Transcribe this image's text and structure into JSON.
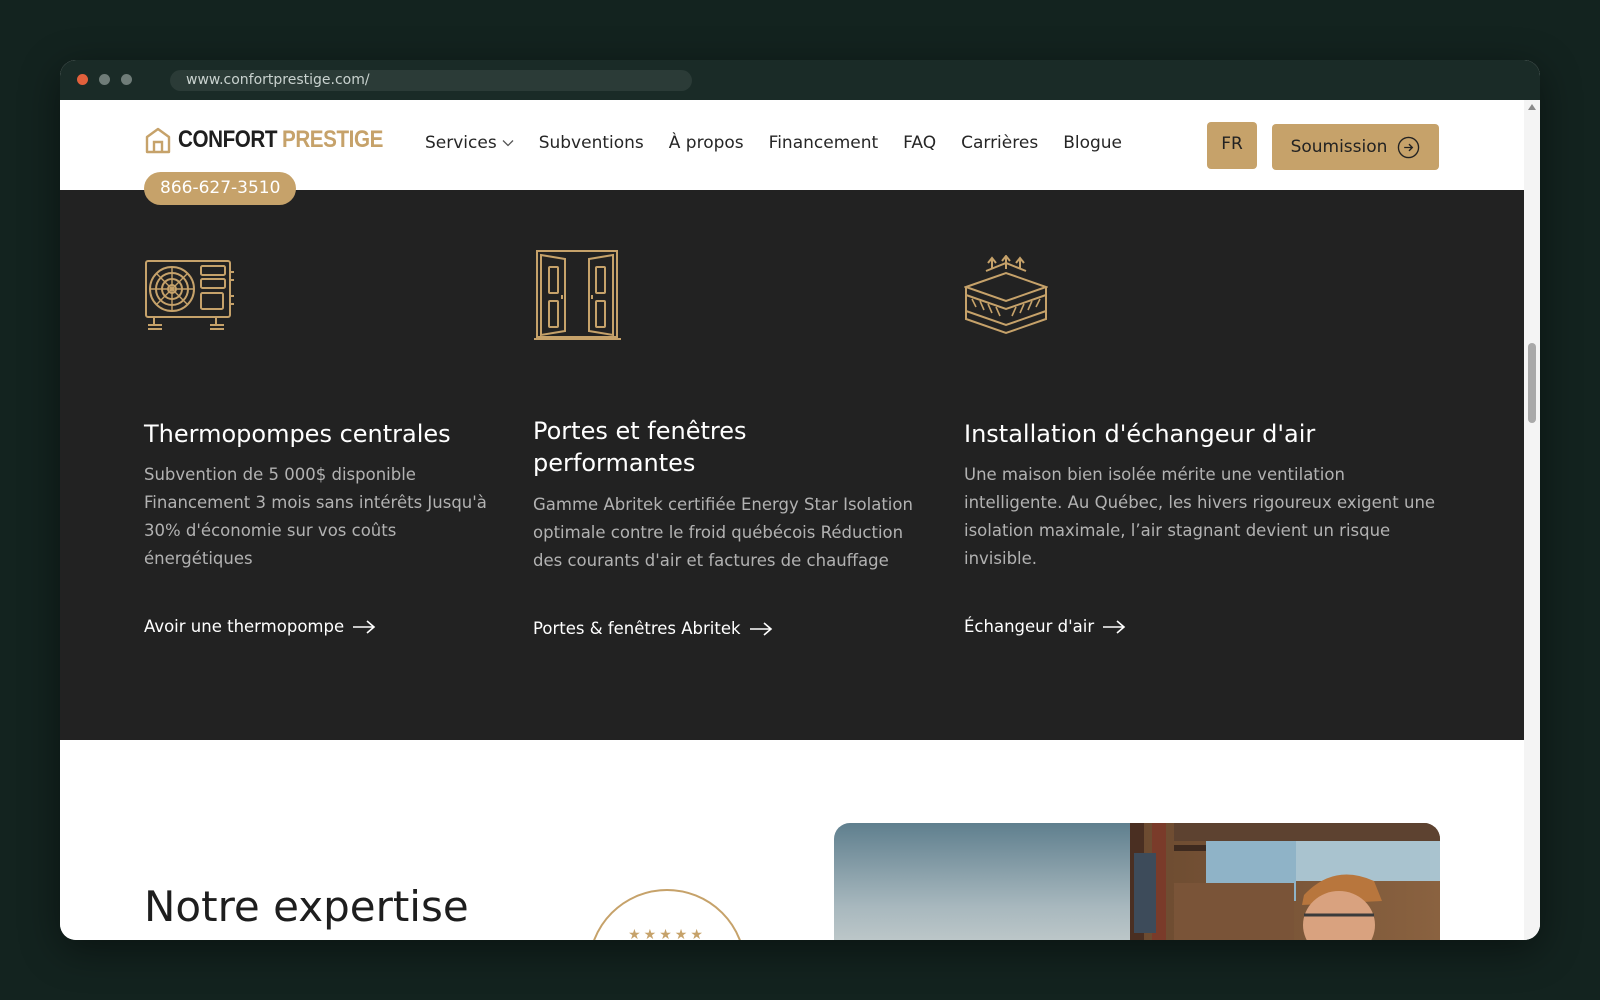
{
  "browser": {
    "url": "www.confortprestige.com/"
  },
  "header": {
    "logo_word1": "CONFORT",
    "logo_word2": "PRESTIGE",
    "phone": "866-627-3510",
    "nav": [
      {
        "label": "Services"
      },
      {
        "label": "Subventions"
      },
      {
        "label": "À propos"
      },
      {
        "label": "Financement"
      },
      {
        "label": "FAQ"
      },
      {
        "label": "Carrières"
      },
      {
        "label": "Blogue"
      }
    ],
    "lang_button": "FR",
    "cta_button": "Soumission"
  },
  "services": [
    {
      "icon": "heat-pump-icon",
      "title": "Thermopompes centrales",
      "description": "Subvention de 5 000$ disponible Financement 3 mois sans intérêts Jusqu'à 30% d'économie sur vos coûts énergétiques",
      "link": "Avoir une thermopompe"
    },
    {
      "icon": "door-window-icon",
      "title": "Portes et fenêtres performantes",
      "description": "Gamme Abritek certifiée Energy Star Isolation optimale contre le froid québécois Réduction des courants d'air et factures de chauffage",
      "link": "Portes & fenêtres Abritek"
    },
    {
      "icon": "insulation-icon",
      "title": "Installation d'échangeur d'air",
      "description": "Une maison bien isolée mérite une ventilation intelligente. Au Québec, les hivers rigoureux exigent une isolation maximale, l’air stagnant devient un risque invisible.",
      "link": "Échangeur d'air"
    }
  ],
  "expertise": {
    "title": "Notre expertise",
    "seal_stars": "★★★★★"
  },
  "colors": {
    "accent": "#c6a26a",
    "dark_section": "#222222",
    "desktop_bg": "#13231f"
  }
}
